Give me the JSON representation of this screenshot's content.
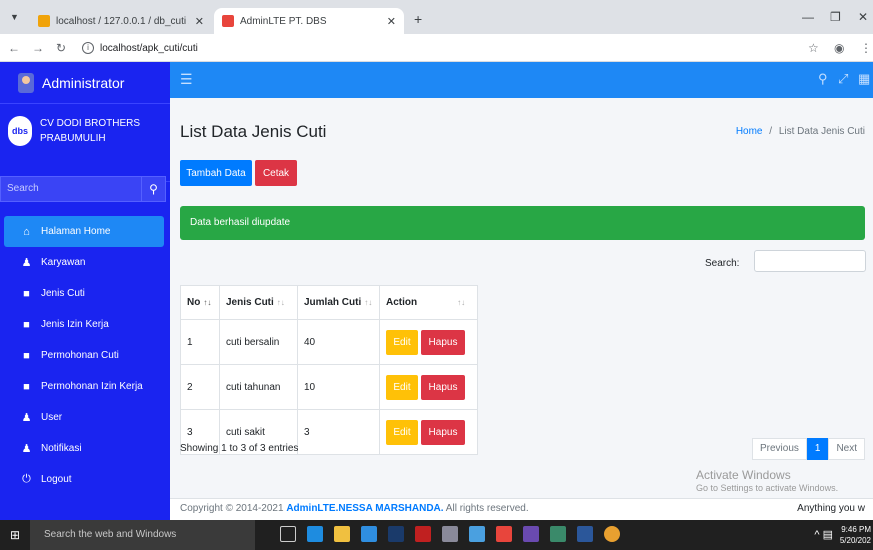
{
  "browser": {
    "tabs": [
      {
        "title": "localhost / 127.0.0.1 / db_cuti /"
      },
      {
        "title": "AdminLTE PT. DBS"
      }
    ],
    "address": "localhost/apk_cuti/cuti"
  },
  "sidebar": {
    "user_name": "Administrator",
    "brand_line1": "CV DODI BROTHERS",
    "brand_line2": "PRABUMULIH",
    "brand_logo": "dbs",
    "search_placeholder": "Search",
    "items": [
      {
        "label": "Halaman Home",
        "icon": "home-icon"
      },
      {
        "label": "Karyawan",
        "icon": "user-icon"
      },
      {
        "label": "Jenis Cuti",
        "icon": "folder-icon"
      },
      {
        "label": "Jenis Izin Kerja",
        "icon": "folder-icon"
      },
      {
        "label": "Permohonan Cuti",
        "icon": "folder-icon"
      },
      {
        "label": "Permohonan Izin Kerja",
        "icon": "folder-icon"
      },
      {
        "label": "User",
        "icon": "user-icon"
      },
      {
        "label": "Notifikasi",
        "icon": "user-icon"
      },
      {
        "label": "Logout",
        "icon": "power-icon"
      }
    ]
  },
  "header": {
    "title": "List Data Jenis Cuti",
    "breadcrumb_home": "Home",
    "breadcrumb_sep": "/",
    "breadcrumb_current": "List Data Jenis Cuti"
  },
  "actions": {
    "add_label": "Tambah Data",
    "print_label": "Cetak"
  },
  "alert": "Data berhasil diupdate",
  "table": {
    "search_label": "Search:",
    "columns": [
      "No",
      "Jenis Cuti",
      "Jumlah Cuti",
      "Action"
    ],
    "rows": [
      {
        "no": "1",
        "jenis": "cuti bersalin",
        "jumlah": "40"
      },
      {
        "no": "2",
        "jenis": "cuti tahunan",
        "jumlah": "10"
      },
      {
        "no": "3",
        "jenis": "cuti sakit",
        "jumlah": "3"
      }
    ],
    "edit_label": "Edit",
    "delete_label": "Hapus",
    "info": "Showing 1 to 3 of 3 entries",
    "pagination": {
      "previous": "Previous",
      "current": "1",
      "next": "Next"
    }
  },
  "footer": {
    "copyright_prefix": "Copyright © 2014-2021",
    "copyright_brand": "AdminLTE.NESSA MARSHANDA.",
    "copyright_suffix": "All rights reserved.",
    "right_text": "Anything you w"
  },
  "watermark": {
    "title": "Activate Windows",
    "subtitle": "Go to Settings to activate Windows."
  },
  "taskbar": {
    "search_placeholder": "Search the web and Windows",
    "time": "9:46 PM",
    "date": "5/20/202"
  },
  "colors": {
    "sidebar": "#1a24f0",
    "navbar": "#1e88f5",
    "primary": "#007bff",
    "danger": "#dc3545",
    "success": "#28a745",
    "warning": "#ffc107"
  }
}
